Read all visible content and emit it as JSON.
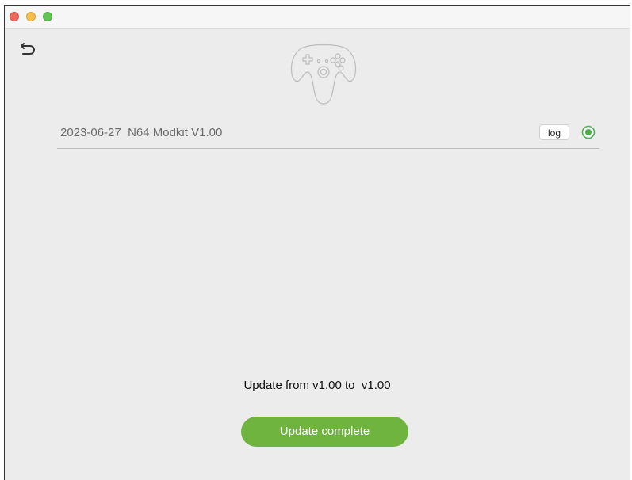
{
  "window": {
    "traffic_lights": [
      "close",
      "minimize",
      "maximize"
    ]
  },
  "header": {
    "back_icon": "undo-arrow-icon",
    "logo_icon": "n64-controller-icon"
  },
  "firmware": {
    "label": "2023-06-27  N64 Modkit V1.00",
    "log_label": "log",
    "selected": true
  },
  "update": {
    "status_text": "Update from v1.00 to  v1.00",
    "button_label": "Update complete"
  },
  "colors": {
    "accent_green": "#6fb43f",
    "radio_green": "#4caf50",
    "background": "#ececec"
  }
}
